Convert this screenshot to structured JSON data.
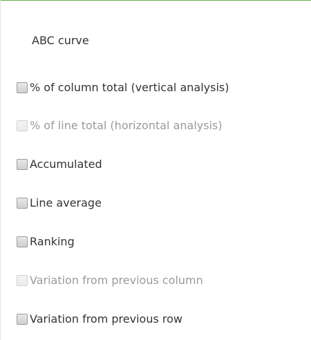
{
  "panel": {
    "title": "ABC curve",
    "options": [
      {
        "label": "% of column total (vertical analysis)",
        "checked": false,
        "enabled": true
      },
      {
        "label": "% of line total (horizontal analysis)",
        "checked": false,
        "enabled": false
      },
      {
        "label": "Accumulated",
        "checked": false,
        "enabled": true
      },
      {
        "label": "Line average",
        "checked": false,
        "enabled": true
      },
      {
        "label": "Ranking",
        "checked": false,
        "enabled": true
      },
      {
        "label": "Variation from previous column",
        "checked": false,
        "enabled": false
      },
      {
        "label": "Variation from previous row",
        "checked": false,
        "enabled": true
      }
    ]
  },
  "colors": {
    "top_border": "#6aa84f",
    "text": "#333333",
    "disabled_text": "#9a9a9a"
  }
}
